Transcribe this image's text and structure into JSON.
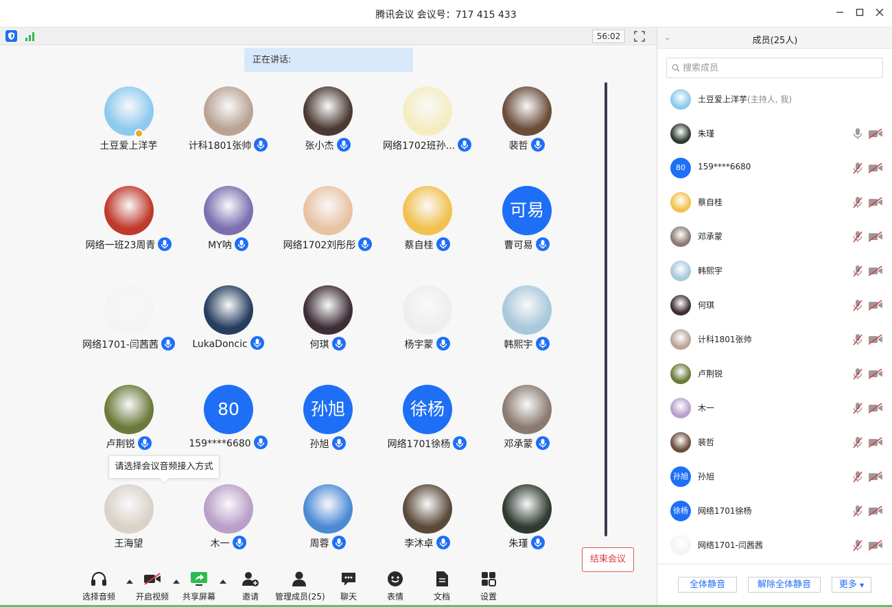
{
  "window": {
    "title": "腾讯会议 会议号：717 415 433"
  },
  "status": {
    "timer": "56:02",
    "speaking_label": "正在讲话:"
  },
  "colors": {
    "accent": "#1e6ff5",
    "danger": "#e0373d",
    "speaking_bg": "#d8e8fb"
  },
  "tiles": [
    {
      "name": "土豆爱上洋芋",
      "host": true,
      "mic": false,
      "avatar_text": "",
      "color": "#8ec9ef"
    },
    {
      "name": "计科1801张帅",
      "mic": true,
      "avatar_text": "",
      "color": "#b9a394"
    },
    {
      "name": "张小杰",
      "mic": true,
      "avatar_text": "",
      "color": "#4a3a33"
    },
    {
      "name": "网络1702班孙...",
      "mic": true,
      "avatar_text": "",
      "color": "#f5edc0"
    },
    {
      "name": "裴哲",
      "mic": true,
      "avatar_text": "",
      "color": "#6b4d3a"
    },
    {
      "name": "网络一班23周青",
      "mic": true,
      "avatar_text": "",
      "color": "#c0392b"
    },
    {
      "name": "MY呐",
      "mic": true,
      "avatar_text": "",
      "color": "#7b6fb0"
    },
    {
      "name": "网络1702刘彤彤",
      "mic": true,
      "avatar_text": "",
      "color": "#e8c3a3"
    },
    {
      "name": "蔡自桂",
      "mic": true,
      "avatar_text": "",
      "color": "#f2c14e"
    },
    {
      "name": "曹可易",
      "mic": true,
      "avatar_text": "可易",
      "color": "#1e6ff5"
    },
    {
      "name": "网络1701-闫茜茜",
      "mic": true,
      "avatar_text": "",
      "color": "#f4f4f4"
    },
    {
      "name": "LukaDoncic",
      "mic": true,
      "avatar_text": "",
      "color": "#253e5f"
    },
    {
      "name": "何琪",
      "mic": true,
      "avatar_text": "",
      "color": "#3d2d35"
    },
    {
      "name": "杨宇蒙",
      "mic": true,
      "avatar_text": "",
      "color": "#eeeeee"
    },
    {
      "name": "韩熙宇",
      "mic": true,
      "avatar_text": "",
      "color": "#a8c8dc"
    },
    {
      "name": "卢荆锐",
      "mic": true,
      "avatar_text": "",
      "color": "#6b7a3a"
    },
    {
      "name": "159****6680",
      "mic": true,
      "avatar_text": "80",
      "color": "#1e6ff5"
    },
    {
      "name": "孙旭",
      "mic": true,
      "avatar_text": "孙旭",
      "color": "#1e6ff5"
    },
    {
      "name": "网络1701徐杨",
      "mic": true,
      "avatar_text": "徐杨",
      "color": "#1e6ff5"
    },
    {
      "name": "邓承蒙",
      "mic": true,
      "avatar_text": "",
      "color": "#8a7a70"
    },
    {
      "name": "王海望",
      "mic": false,
      "avatar_text": "",
      "color": "#d9d2c8"
    },
    {
      "name": "木一",
      "mic": true,
      "avatar_text": "",
      "color": "#b99fc9"
    },
    {
      "name": "周蓉",
      "mic": true,
      "avatar_text": "",
      "color": "#4c8ad6"
    },
    {
      "name": "李沐卓",
      "mic": true,
      "avatar_text": "",
      "color": "#5a4a3a"
    },
    {
      "name": "朱瑾",
      "mic": true,
      "avatar_text": "",
      "color": "#2f3a30"
    }
  ],
  "tooltip": "请选择会议音频接入方式",
  "toolbar": {
    "audio": "选择音频",
    "video": "开启视频",
    "share": "共享屏幕",
    "invite": "邀请",
    "members": "管理成员(25)",
    "chat": "聊天",
    "emoji": "表情",
    "docs": "文档",
    "settings": "设置",
    "end": "结束会议"
  },
  "sidebar": {
    "title": "成员(25人)",
    "search_placeholder": "搜索成员",
    "members": [
      {
        "name": "土豆爱上洋芋",
        "role": "(主持人, 我)",
        "avatar_text": "",
        "color": "#8ec9ef",
        "controls": false
      },
      {
        "name": "朱瑾",
        "role": "",
        "avatar_text": "",
        "color": "#2f3a30",
        "controls": true,
        "mic_muted": false
      },
      {
        "name": "159****6680",
        "role": "",
        "avatar_text": "80",
        "color": "#1e6ff5",
        "controls": true,
        "mic_muted": true
      },
      {
        "name": "蔡自桂",
        "role": "",
        "avatar_text": "",
        "color": "#f2c14e",
        "controls": true,
        "mic_muted": true
      },
      {
        "name": "邓承蒙",
        "role": "",
        "avatar_text": "",
        "color": "#8a7a70",
        "controls": true,
        "mic_muted": true
      },
      {
        "name": "韩熙宇",
        "role": "",
        "avatar_text": "",
        "color": "#a8c8dc",
        "controls": true,
        "mic_muted": true
      },
      {
        "name": "何琪",
        "role": "",
        "avatar_text": "",
        "color": "#3d2d35",
        "controls": true,
        "mic_muted": true
      },
      {
        "name": "计科1801张帅",
        "role": "",
        "avatar_text": "",
        "color": "#b9a394",
        "controls": true,
        "mic_muted": true
      },
      {
        "name": "卢荆锐",
        "role": "",
        "avatar_text": "",
        "color": "#6b7a3a",
        "controls": true,
        "mic_muted": true
      },
      {
        "name": "木一",
        "role": "",
        "avatar_text": "",
        "color": "#b99fc9",
        "controls": true,
        "mic_muted": true
      },
      {
        "name": "裴哲",
        "role": "",
        "avatar_text": "",
        "color": "#6b4d3a",
        "controls": true,
        "mic_muted": true
      },
      {
        "name": "孙旭",
        "role": "",
        "avatar_text": "孙旭",
        "color": "#1e6ff5",
        "controls": true,
        "mic_muted": true
      },
      {
        "name": "网络1701徐杨",
        "role": "",
        "avatar_text": "徐杨",
        "color": "#1e6ff5",
        "controls": true,
        "mic_muted": true
      },
      {
        "name": "网络1701-闫茜茜",
        "role": "",
        "avatar_text": "",
        "color": "#f4f4f4",
        "controls": true,
        "mic_muted": true
      }
    ],
    "mute_all": "全体静音",
    "unmute_all": "解除全体静音",
    "more": "更多"
  }
}
